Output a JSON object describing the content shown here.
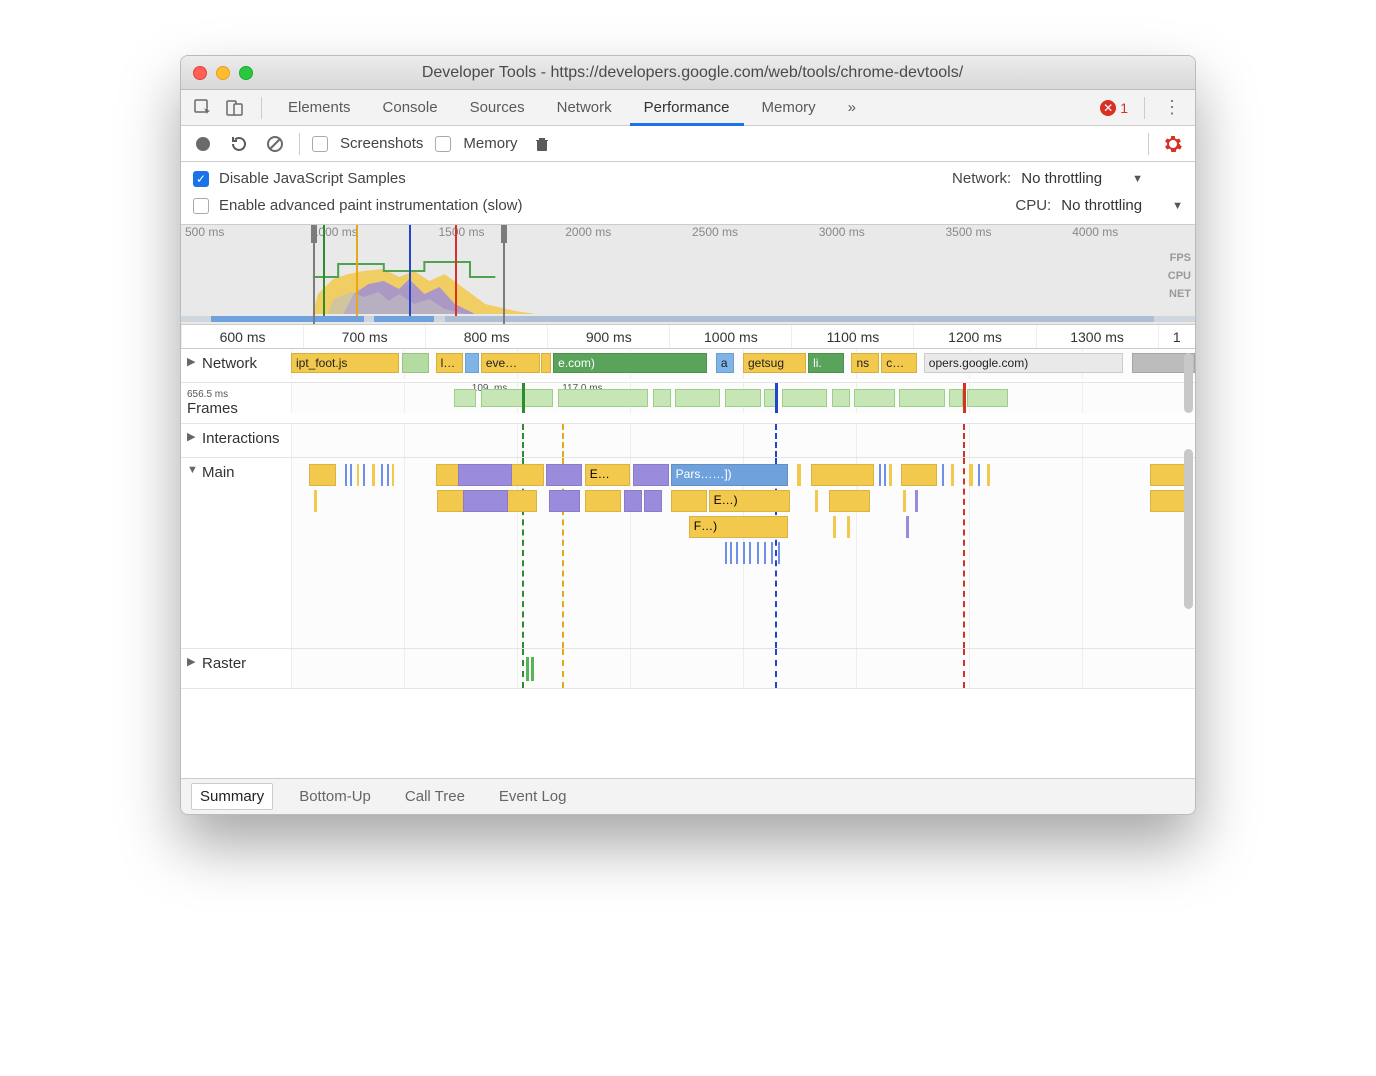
{
  "window": {
    "title": "Developer Tools - https://developers.google.com/web/tools/chrome-devtools/"
  },
  "tabs": {
    "elements": "Elements",
    "console": "Console",
    "sources": "Sources",
    "network": "Network",
    "performance": "Performance",
    "memory": "Memory",
    "more": "»",
    "error_count": "1"
  },
  "perf_toolbar": {
    "screenshots": "Screenshots",
    "memory": "Memory"
  },
  "settings": {
    "disable_js": "Disable JavaScript Samples",
    "enable_paint": "Enable advanced paint instrumentation (slow)",
    "network_label": "Network:",
    "network_value": "No throttling",
    "cpu_label": "CPU:",
    "cpu_value": "No throttling"
  },
  "overview": {
    "ticks": [
      "500 ms",
      "1000 ms",
      "1500 ms",
      "2000 ms",
      "2500 ms",
      "3000 ms",
      "3500 ms",
      "4000 ms"
    ],
    "lane_labels": [
      "FPS",
      "CPU",
      "NET"
    ]
  },
  "ruler": [
    "600 ms",
    "700 ms",
    "800 ms",
    "900 ms",
    "1000 ms",
    "1100 ms",
    "1200 ms",
    "1300 ms",
    "1"
  ],
  "tracks": {
    "network": "Network",
    "frames": "Frames",
    "interactions": "Interactions",
    "main": "Main",
    "raster": "Raster"
  },
  "network_items": {
    "a": "ipt_foot.js",
    "b": "l…",
    "c": "eve…",
    "d": "e.com)",
    "e": "a",
    "f": "getsug",
    "g": "li.",
    "h": "ns",
    "i": "c…",
    "j": "opers.google.com)"
  },
  "frames": {
    "t0": "656.5 ms",
    "f1": "109. ms",
    "f2": "117.0 ms"
  },
  "flame": {
    "e1": "E…",
    "p1": "Pars……])",
    "e2": "E…)",
    "f1": "F…)"
  },
  "bottom_tabs": {
    "summary": "Summary",
    "bottomup": "Bottom-Up",
    "calltree": "Call Tree",
    "eventlog": "Event Log"
  },
  "colors": {
    "scripting": "#f2c94c",
    "rendering": "#9b8bdc",
    "loading": "#6fa2dc",
    "painting": "#6ac07a",
    "green_net": "#5aa35a",
    "yellow_net": "#f2c94c",
    "blue_net": "#6fa2dc"
  }
}
